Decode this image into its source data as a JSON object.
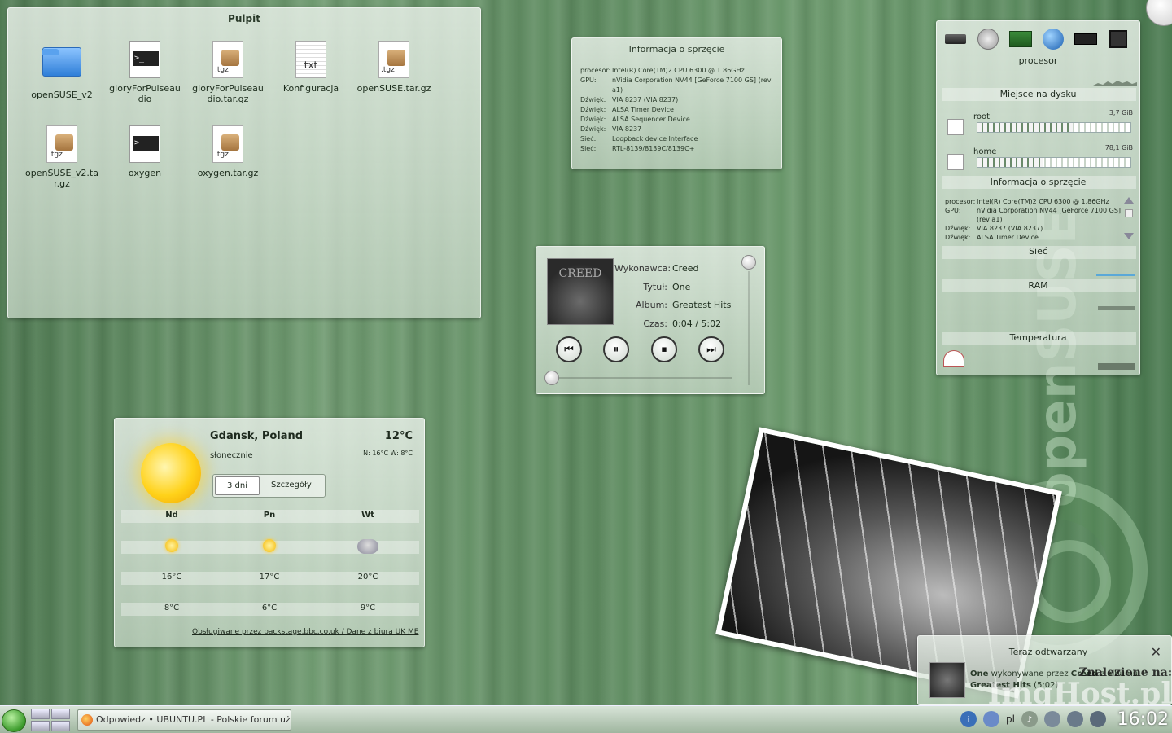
{
  "wallpaper": {
    "brand": "openSUSE"
  },
  "desktop_folder": {
    "title": "Pulpit",
    "items": [
      {
        "label": "openSUSE_v2",
        "icon": "folder-icon"
      },
      {
        "label": "gloryForPulseaudio",
        "icon": "script-icon"
      },
      {
        "label": "gloryForPulseaudio.tar.gz",
        "icon": "archive-icon",
        "tag": ".tgz"
      },
      {
        "label": "Konfiguracja",
        "icon": "text-file-icon",
        "tag": "txt"
      },
      {
        "label": "openSUSE.tar.gz",
        "icon": "archive-icon",
        "tag": ".tgz"
      },
      {
        "label": "openSUSE_v2.tar.gz",
        "icon": "archive-icon",
        "tag": ".tgz"
      },
      {
        "label": "oxygen",
        "icon": "script-icon"
      },
      {
        "label": "oxygen.tar.gz",
        "icon": "archive-icon",
        "tag": ".tgz"
      }
    ]
  },
  "hw_info": {
    "title": "Informacja o sprzęcie",
    "rows": [
      {
        "k": "procesor:",
        "v": "Intel(R) Core(TM)2 CPU 6300 @ 1.86GHz"
      },
      {
        "k": "GPU:",
        "v": "nVidia Corporation NV44 [GeForce 7100 GS] (rev a1)"
      },
      {
        "k": "Dźwięk:",
        "v": "VIA 8237 (VIA 8237)"
      },
      {
        "k": "Dźwięk:",
        "v": "ALSA Timer Device"
      },
      {
        "k": "Dźwięk:",
        "v": "ALSA Sequencer Device"
      },
      {
        "k": "Dźwięk:",
        "v": "VIA 8237"
      },
      {
        "k": "Sieć:",
        "v": "Loopback device Interface"
      },
      {
        "k": "Sieć:",
        "v": "RTL-8139/8139C/8139C+"
      }
    ]
  },
  "now_playing": {
    "art_text": "CREED",
    "artist_label": "Wykonawca:",
    "artist": "Creed",
    "title_label": "Tytuł:",
    "title": "One",
    "album_label": "Album:",
    "album": "Greatest Hits",
    "time_label": "Czas:",
    "time": "0:04 / 5:02",
    "controls": {
      "prev": "⏮",
      "pause": "⏸",
      "stop": "⏹",
      "next": "⏭"
    }
  },
  "sys_monitor": {
    "cpu_label": "procesor",
    "disk_title": "Miejsce na dysku",
    "disks": [
      {
        "name": "root",
        "size": "3,7 GiB",
        "used": 0.62
      },
      {
        "name": "home",
        "size": "78,1 GiB",
        "used": 0.43
      }
    ],
    "hw_title": "Informacja o sprzęcie",
    "hw_rows": [
      {
        "k": "procesor:",
        "v": "Intel(R) Core(TM)2 CPU 6300 @ 1.86GHz"
      },
      {
        "k": "GPU:",
        "v": "nVidia Corporation NV44 [GeForce 7100 GS] (rev a1)"
      },
      {
        "k": "Dźwięk:",
        "v": "VIA 8237 (VIA 8237)"
      },
      {
        "k": "Dźwięk:",
        "v": "ALSA Timer Device"
      }
    ],
    "net_title": "Sieć",
    "ram_title": "RAM",
    "temp_title": "Temperatura",
    "colors": {
      "net_line": "#5aa8d8",
      "ram_line": "#7a8a7a",
      "temp_line": "#6a7a6a"
    }
  },
  "weather": {
    "location": "Gdansk, Poland",
    "temp": "12°C",
    "condition": "słonecznie",
    "range": "N: 16°C W: 8°C",
    "tabs": [
      "3 dni",
      "Szczegóły"
    ],
    "days": [
      {
        "name": "Nd",
        "icon": "sun-icon",
        "high": "16°C",
        "low": "8°C"
      },
      {
        "name": "Pn",
        "icon": "sun-icon",
        "high": "17°C",
        "low": "6°C"
      },
      {
        "name": "Wt",
        "icon": "storm-icon",
        "high": "20°C",
        "low": "9°C"
      }
    ],
    "footer": "Obsługiwane przez backstage.bbc.co.uk / Dane z biura UK ME"
  },
  "notification": {
    "title": "Teraz odtwarzany",
    "track": "One",
    "mid": " wykonywane przez ",
    "artist": "Creed",
    "mid2": " z albumu ",
    "album": "Greatest Hits",
    "duration": " (5:02)"
  },
  "watermark": {
    "line1": "Znalezione na:",
    "line2": "ImgHost.pl"
  },
  "taskbar": {
    "task_title": "Odpowiedz • UBUNTU.PL - Polskie forum użytkowników",
    "keyboard_layout": "pl",
    "clock": "16:02"
  }
}
